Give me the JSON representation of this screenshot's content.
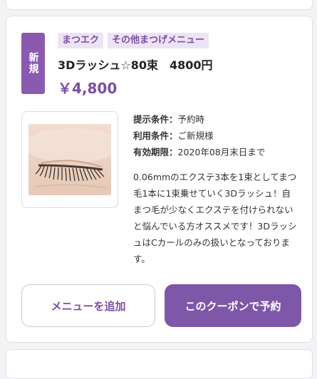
{
  "coupon": {
    "badge": "新規",
    "tags": [
      "まつエク",
      "その他まつげメニュー"
    ],
    "title": "3Dラッシュ☆80束　4800円",
    "price": "￥4,800",
    "conditions": [
      {
        "label": "提示条件：",
        "value": "予約時"
      },
      {
        "label": "利用条件：",
        "value": "ご新規様"
      },
      {
        "label": "有効期限：",
        "value": "2020年08月末日まで"
      }
    ],
    "description": "0.06mmのエクステ3本を1束としてまつ毛1本に1束乗せていく3Dラッシュ！自まつ毛が少なくエクステを付けられないと悩んでいる方オススメです！3DラッシュはCカールのみの扱いとなっております。",
    "image_subject": "closed eye with eyelash extensions"
  },
  "actions": {
    "add_menu_label": "メニューを追加",
    "reserve_label": "このクーポンで予約"
  },
  "colors": {
    "accent": "#7e57a8",
    "tag_bg": "#ece3f5"
  }
}
